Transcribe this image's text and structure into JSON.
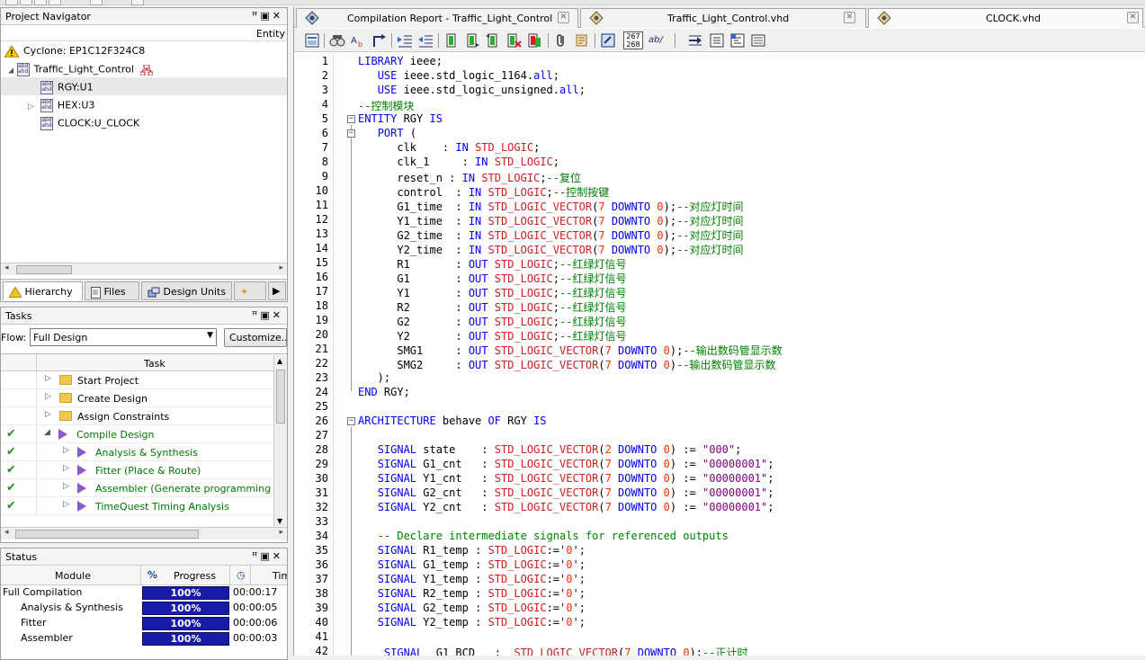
{
  "project_navigator": {
    "title": "Project Navigator",
    "column": "Entity",
    "device": "Cyclone: EP1C12F324C8",
    "top": "Traffic_Light_Control",
    "items": [
      "RGY:U1",
      "HEX:U3",
      "CLOCK:U_CLOCK"
    ],
    "tabs": [
      "Hierarchy",
      "Files",
      "Design Units"
    ]
  },
  "tasks": {
    "title": "Tasks",
    "flow_label": "Flow:",
    "flow_value": "Full Design",
    "customize": "Customize...",
    "column": "Task",
    "rows": [
      {
        "label": "Start Project",
        "done": false,
        "kind": "folder",
        "indent": 0
      },
      {
        "label": "Create Design",
        "done": false,
        "kind": "folder",
        "indent": 0
      },
      {
        "label": "Assign Constraints",
        "done": false,
        "kind": "folder",
        "indent": 0
      },
      {
        "label": "Compile Design",
        "done": true,
        "kind": "play",
        "indent": 0
      },
      {
        "label": "Analysis & Synthesis",
        "done": true,
        "kind": "play",
        "indent": 1
      },
      {
        "label": "Fitter (Place & Route)",
        "done": true,
        "kind": "play",
        "indent": 1
      },
      {
        "label": "Assembler (Generate programming files)",
        "done": true,
        "kind": "play",
        "indent": 1
      },
      {
        "label": "TimeQuest Timing Analysis",
        "done": true,
        "kind": "play",
        "indent": 1
      }
    ]
  },
  "status": {
    "title": "Status",
    "columns": [
      "Module",
      "%",
      "Progress",
      "Time"
    ],
    "rows": [
      {
        "module": "Full Compilation",
        "progress": "100%",
        "time": "00:00:17",
        "indent": false
      },
      {
        "module": "Analysis & Synthesis",
        "progress": "100%",
        "time": "00:00:05",
        "indent": true
      },
      {
        "module": "Fitter",
        "progress": "100%",
        "time": "00:00:06",
        "indent": true
      },
      {
        "module": "Assembler",
        "progress": "100%",
        "time": "00:00:03",
        "indent": true
      }
    ]
  },
  "editor": {
    "tabs": [
      "Compilation Report - Traffic_Light_Control",
      "Traffic_Light_Control.vhd",
      "CLOCK.vhd"
    ],
    "toolbar_badge": "267\n268",
    "toolbar_ab": "ab/",
    "lines": [
      [
        [
          "kw",
          "LIBRARY"
        ],
        [
          "t",
          " ieee;"
        ]
      ],
      [
        [
          "t",
          "   "
        ],
        [
          "kw",
          "USE"
        ],
        [
          "t",
          " ieee.std_logic_1164."
        ],
        [
          "kw",
          "all"
        ],
        [
          "t",
          ";"
        ]
      ],
      [
        [
          "t",
          "   "
        ],
        [
          "kw",
          "USE"
        ],
        [
          "t",
          " ieee.std_logic_unsigned."
        ],
        [
          "kw",
          "all"
        ],
        [
          "t",
          ";"
        ]
      ],
      [
        [
          "cm",
          "--控制模块"
        ]
      ],
      [
        [
          "kw",
          "ENTITY"
        ],
        [
          "t",
          " RGY "
        ],
        [
          "kw",
          "IS"
        ]
      ],
      [
        [
          "t",
          "   "
        ],
        [
          "kw",
          "PORT"
        ],
        [
          "t",
          " ("
        ]
      ],
      [
        [
          "t",
          "      clk    : "
        ],
        [
          "kw",
          "IN"
        ],
        [
          "t",
          " "
        ],
        [
          "ty",
          "STD_LOGIC"
        ],
        [
          "t",
          ";"
        ]
      ],
      [
        [
          "t",
          "      clk_1     : "
        ],
        [
          "kw",
          "IN"
        ],
        [
          "t",
          " "
        ],
        [
          "ty",
          "STD_LOGIC"
        ],
        [
          "t",
          ";"
        ]
      ],
      [
        [
          "t",
          "      reset_n : "
        ],
        [
          "kw",
          "IN"
        ],
        [
          "t",
          " "
        ],
        [
          "ty",
          "STD_LOGIC"
        ],
        [
          "t",
          ";"
        ],
        [
          "cm",
          "--复位"
        ]
      ],
      [
        [
          "t",
          "      control  : "
        ],
        [
          "kw",
          "IN"
        ],
        [
          "t",
          " "
        ],
        [
          "ty",
          "STD_LOGIC"
        ],
        [
          "t",
          ";"
        ],
        [
          "cm",
          "--控制按键"
        ]
      ],
      [
        [
          "t",
          "      G1_time  : "
        ],
        [
          "kw",
          "IN"
        ],
        [
          "t",
          " "
        ],
        [
          "ty",
          "STD_LOGIC_VECTOR"
        ],
        [
          "t",
          "("
        ],
        [
          "num",
          "7"
        ],
        [
          "t",
          " "
        ],
        [
          "kw",
          "DOWNTO"
        ],
        [
          "t",
          " "
        ],
        [
          "num",
          "0"
        ],
        [
          "t",
          ");"
        ],
        [
          "cm",
          "--对应灯时间"
        ]
      ],
      [
        [
          "t",
          "      Y1_time  : "
        ],
        [
          "kw",
          "IN"
        ],
        [
          "t",
          " "
        ],
        [
          "ty",
          "STD_LOGIC_VECTOR"
        ],
        [
          "t",
          "("
        ],
        [
          "num",
          "7"
        ],
        [
          "t",
          " "
        ],
        [
          "kw",
          "DOWNTO"
        ],
        [
          "t",
          " "
        ],
        [
          "num",
          "0"
        ],
        [
          "t",
          ");"
        ],
        [
          "cm",
          "--对应灯时间"
        ]
      ],
      [
        [
          "t",
          "      G2_time  : "
        ],
        [
          "kw",
          "IN"
        ],
        [
          "t",
          " "
        ],
        [
          "ty",
          "STD_LOGIC_VECTOR"
        ],
        [
          "t",
          "("
        ],
        [
          "num",
          "7"
        ],
        [
          "t",
          " "
        ],
        [
          "kw",
          "DOWNTO"
        ],
        [
          "t",
          " "
        ],
        [
          "num",
          "0"
        ],
        [
          "t",
          ");"
        ],
        [
          "cm",
          "--对应灯时间"
        ]
      ],
      [
        [
          "t",
          "      Y2_time  : "
        ],
        [
          "kw",
          "IN"
        ],
        [
          "t",
          " "
        ],
        [
          "ty",
          "STD_LOGIC_VECTOR"
        ],
        [
          "t",
          "("
        ],
        [
          "num",
          "7"
        ],
        [
          "t",
          " "
        ],
        [
          "kw",
          "DOWNTO"
        ],
        [
          "t",
          " "
        ],
        [
          "num",
          "0"
        ],
        [
          "t",
          ");"
        ],
        [
          "cm",
          "--对应灯时间"
        ]
      ],
      [
        [
          "t",
          "      R1       : "
        ],
        [
          "kw",
          "OUT"
        ],
        [
          "t",
          " "
        ],
        [
          "ty",
          "STD_LOGIC"
        ],
        [
          "t",
          ";"
        ],
        [
          "cm",
          "--红绿灯信号"
        ]
      ],
      [
        [
          "t",
          "      G1       : "
        ],
        [
          "kw",
          "OUT"
        ],
        [
          "t",
          " "
        ],
        [
          "ty",
          "STD_LOGIC"
        ],
        [
          "t",
          ";"
        ],
        [
          "cm",
          "--红绿灯信号"
        ]
      ],
      [
        [
          "t",
          "      Y1       : "
        ],
        [
          "kw",
          "OUT"
        ],
        [
          "t",
          " "
        ],
        [
          "ty",
          "STD_LOGIC"
        ],
        [
          "t",
          ";"
        ],
        [
          "cm",
          "--红绿灯信号"
        ]
      ],
      [
        [
          "t",
          "      R2       : "
        ],
        [
          "kw",
          "OUT"
        ],
        [
          "t",
          " "
        ],
        [
          "ty",
          "STD_LOGIC"
        ],
        [
          "t",
          ";"
        ],
        [
          "cm",
          "--红绿灯信号"
        ]
      ],
      [
        [
          "t",
          "      G2       : "
        ],
        [
          "kw",
          "OUT"
        ],
        [
          "t",
          " "
        ],
        [
          "ty",
          "STD_LOGIC"
        ],
        [
          "t",
          ";"
        ],
        [
          "cm",
          "--红绿灯信号"
        ]
      ],
      [
        [
          "t",
          "      Y2       : "
        ],
        [
          "kw",
          "OUT"
        ],
        [
          "t",
          " "
        ],
        [
          "ty",
          "STD_LOGIC"
        ],
        [
          "t",
          ";"
        ],
        [
          "cm",
          "--红绿灯信号"
        ]
      ],
      [
        [
          "t",
          "      SMG1     : "
        ],
        [
          "kw",
          "OUT"
        ],
        [
          "t",
          " "
        ],
        [
          "ty",
          "STD_LOGIC_VECTOR"
        ],
        [
          "t",
          "("
        ],
        [
          "num",
          "7"
        ],
        [
          "t",
          " "
        ],
        [
          "kw",
          "DOWNTO"
        ],
        [
          "t",
          " "
        ],
        [
          "num",
          "0"
        ],
        [
          "t",
          ");"
        ],
        [
          "cm",
          "--输出数码管显示数"
        ]
      ],
      [
        [
          "t",
          "      SMG2     : "
        ],
        [
          "kw",
          "OUT"
        ],
        [
          "t",
          " "
        ],
        [
          "ty",
          "STD_LOGIC_VECTOR"
        ],
        [
          "t",
          "("
        ],
        [
          "num",
          "7"
        ],
        [
          "t",
          " "
        ],
        [
          "kw",
          "DOWNTO"
        ],
        [
          "t",
          " "
        ],
        [
          "num",
          "0"
        ],
        [
          "t",
          ")"
        ],
        [
          "cm",
          "--输出数码管显示数"
        ]
      ],
      [
        [
          "t",
          "   );"
        ]
      ],
      [
        [
          "kw",
          "END"
        ],
        [
          "t",
          " RGY;"
        ]
      ],
      [
        [
          "t",
          ""
        ]
      ],
      [
        [
          "kw",
          "ARCHITECTURE"
        ],
        [
          "t",
          " behave "
        ],
        [
          "kw",
          "OF"
        ],
        [
          "t",
          " RGY "
        ],
        [
          "kw",
          "IS"
        ]
      ],
      [
        [
          "t",
          ""
        ]
      ],
      [
        [
          "t",
          "   "
        ],
        [
          "kw",
          "SIGNAL"
        ],
        [
          "t",
          " state    : "
        ],
        [
          "ty",
          "STD_LOGIC_VECTOR"
        ],
        [
          "t",
          "("
        ],
        [
          "num",
          "2"
        ],
        [
          "t",
          " "
        ],
        [
          "kw",
          "DOWNTO"
        ],
        [
          "t",
          " "
        ],
        [
          "num",
          "0"
        ],
        [
          "t",
          ") := "
        ],
        [
          "str",
          "\"000\""
        ],
        [
          "t",
          ";"
        ]
      ],
      [
        [
          "t",
          "   "
        ],
        [
          "kw",
          "SIGNAL"
        ],
        [
          "t",
          " G1_cnt   : "
        ],
        [
          "ty",
          "STD_LOGIC_VECTOR"
        ],
        [
          "t",
          "("
        ],
        [
          "num",
          "7"
        ],
        [
          "t",
          " "
        ],
        [
          "kw",
          "DOWNTO"
        ],
        [
          "t",
          " "
        ],
        [
          "num",
          "0"
        ],
        [
          "t",
          ") := "
        ],
        [
          "str",
          "\"00000001\""
        ],
        [
          "t",
          ";"
        ]
      ],
      [
        [
          "t",
          "   "
        ],
        [
          "kw",
          "SIGNAL"
        ],
        [
          "t",
          " Y1_cnt   : "
        ],
        [
          "ty",
          "STD_LOGIC_VECTOR"
        ],
        [
          "t",
          "("
        ],
        [
          "num",
          "7"
        ],
        [
          "t",
          " "
        ],
        [
          "kw",
          "DOWNTO"
        ],
        [
          "t",
          " "
        ],
        [
          "num",
          "0"
        ],
        [
          "t",
          ") := "
        ],
        [
          "str",
          "\"00000001\""
        ],
        [
          "t",
          ";"
        ]
      ],
      [
        [
          "t",
          "   "
        ],
        [
          "kw",
          "SIGNAL"
        ],
        [
          "t",
          " G2_cnt   : "
        ],
        [
          "ty",
          "STD_LOGIC_VECTOR"
        ],
        [
          "t",
          "("
        ],
        [
          "num",
          "7"
        ],
        [
          "t",
          " "
        ],
        [
          "kw",
          "DOWNTO"
        ],
        [
          "t",
          " "
        ],
        [
          "num",
          "0"
        ],
        [
          "t",
          ") := "
        ],
        [
          "str",
          "\"00000001\""
        ],
        [
          "t",
          ";"
        ]
      ],
      [
        [
          "t",
          "   "
        ],
        [
          "kw",
          "SIGNAL"
        ],
        [
          "t",
          " Y2_cnt   : "
        ],
        [
          "ty",
          "STD_LOGIC_VECTOR"
        ],
        [
          "t",
          "("
        ],
        [
          "num",
          "7"
        ],
        [
          "t",
          " "
        ],
        [
          "kw",
          "DOWNTO"
        ],
        [
          "t",
          " "
        ],
        [
          "num",
          "0"
        ],
        [
          "t",
          ") := "
        ],
        [
          "str",
          "\"00000001\""
        ],
        [
          "t",
          ";"
        ]
      ],
      [
        [
          "t",
          ""
        ]
      ],
      [
        [
          "t",
          "   "
        ],
        [
          "cm",
          "-- Declare intermediate signals for referenced outputs"
        ]
      ],
      [
        [
          "t",
          "   "
        ],
        [
          "kw",
          "SIGNAL"
        ],
        [
          "t",
          " R1_temp : "
        ],
        [
          "ty",
          "STD_LOGIC"
        ],
        [
          "t",
          ":='"
        ],
        [
          "num",
          "0"
        ],
        [
          "t",
          "';"
        ]
      ],
      [
        [
          "t",
          "   "
        ],
        [
          "kw",
          "SIGNAL"
        ],
        [
          "t",
          " G1_temp : "
        ],
        [
          "ty",
          "STD_LOGIC"
        ],
        [
          "t",
          ":='"
        ],
        [
          "num",
          "0"
        ],
        [
          "t",
          "';"
        ]
      ],
      [
        [
          "t",
          "   "
        ],
        [
          "kw",
          "SIGNAL"
        ],
        [
          "t",
          " Y1_temp : "
        ],
        [
          "ty",
          "STD_LOGIC"
        ],
        [
          "t",
          ":='"
        ],
        [
          "num",
          "0"
        ],
        [
          "t",
          "';"
        ]
      ],
      [
        [
          "t",
          "   "
        ],
        [
          "kw",
          "SIGNAL"
        ],
        [
          "t",
          " R2_temp : "
        ],
        [
          "ty",
          "STD_LOGIC"
        ],
        [
          "t",
          ":='"
        ],
        [
          "num",
          "0"
        ],
        [
          "t",
          "';"
        ]
      ],
      [
        [
          "t",
          "   "
        ],
        [
          "kw",
          "SIGNAL"
        ],
        [
          "t",
          " G2_temp : "
        ],
        [
          "ty",
          "STD_LOGIC"
        ],
        [
          "t",
          ":='"
        ],
        [
          "num",
          "0"
        ],
        [
          "t",
          "';"
        ]
      ],
      [
        [
          "t",
          "   "
        ],
        [
          "kw",
          "SIGNAL"
        ],
        [
          "t",
          " Y2_temp : "
        ],
        [
          "ty",
          "STD_LOGIC"
        ],
        [
          "t",
          ":='"
        ],
        [
          "num",
          "0"
        ],
        [
          "t",
          "';"
        ]
      ],
      [
        [
          "t",
          ""
        ]
      ],
      [
        [
          "t",
          "    "
        ],
        [
          "kw",
          "SIGNAL"
        ],
        [
          "t",
          "  G1_BCD   :  "
        ],
        [
          "ty",
          "STD_LOGIC_VECTOR"
        ],
        [
          "t",
          "("
        ],
        [
          "num",
          "7"
        ],
        [
          "t",
          " "
        ],
        [
          "kw",
          "DOWNTO"
        ],
        [
          "t",
          " "
        ],
        [
          "num",
          "0"
        ],
        [
          "t",
          ");"
        ],
        [
          "cm",
          "--正计时"
        ]
      ]
    ]
  }
}
